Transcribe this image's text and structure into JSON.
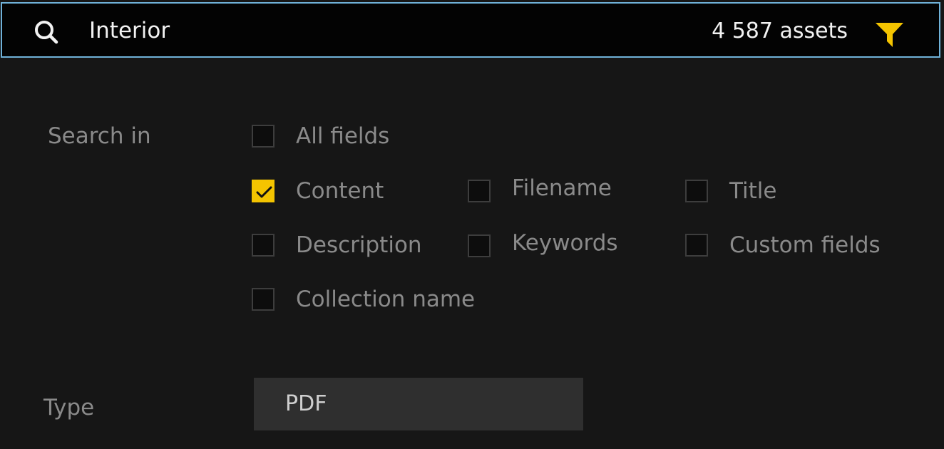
{
  "search": {
    "query": "Interior",
    "asset_count": "4 587 assets",
    "accent_color": "#6fb1d8",
    "filter_color": "#f4c400"
  },
  "search_in": {
    "label": "Search in",
    "options": [
      {
        "label": "All fields",
        "checked": false
      },
      {
        "label": "Content",
        "checked": true
      },
      {
        "label": "Filename",
        "checked": false
      },
      {
        "label": "Title",
        "checked": false
      },
      {
        "label": "Description",
        "checked": false
      },
      {
        "label": "Keywords",
        "checked": false
      },
      {
        "label": "Custom fields",
        "checked": false
      },
      {
        "label": "Collection name",
        "checked": false
      }
    ]
  },
  "type": {
    "label": "Type",
    "selected": "PDF"
  },
  "icons": {
    "search": "search-icon",
    "filter": "filter-icon",
    "check": "check-icon"
  }
}
